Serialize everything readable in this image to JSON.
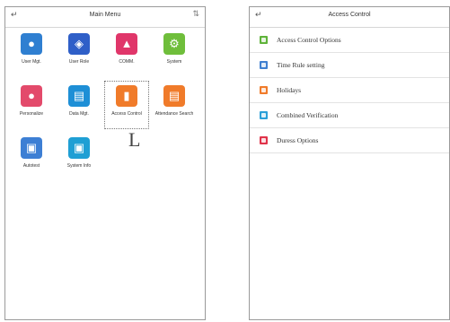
{
  "main_menu": {
    "title": "Main Menu",
    "back_icon": "back-arrow-icon",
    "sort_icon": "sort-arrows-icon",
    "items": [
      {
        "label": "User Mgt.",
        "icon": "user-icon",
        "color": "#2f7fd1"
      },
      {
        "label": "User Role",
        "icon": "shield-icon",
        "color": "#2f5fc8"
      },
      {
        "label": "COMM.",
        "icon": "antenna-icon",
        "color": "#e0366a"
      },
      {
        "label": "System",
        "icon": "gear-icon",
        "color": "#6fbe3b"
      },
      {
        "label": "Personalize",
        "icon": "palette-icon",
        "color": "#e34a6b"
      },
      {
        "label": "Data Mgt.",
        "icon": "database-icon",
        "color": "#1e8fd6"
      },
      {
        "label": "Access Control",
        "icon": "door-icon",
        "color": "#f07b2a"
      },
      {
        "label": "Attendance Search",
        "icon": "document-icon",
        "color": "#f07b2a"
      },
      {
        "label": "Autotest",
        "icon": "test-screen-icon",
        "color": "#3d7fd4"
      },
      {
        "label": "System Info",
        "icon": "monitor-icon",
        "color": "#1f9fd4"
      }
    ],
    "selected": "Access Control"
  },
  "access_control": {
    "title": "Access Control",
    "back_icon": "back-arrow-icon",
    "items": [
      {
        "label": "Access Control Options",
        "color": "#5fb33a"
      },
      {
        "label": "Time Rule setting",
        "color": "#3f7fd0"
      },
      {
        "label": "Holidays",
        "color": "#f07b2a"
      },
      {
        "label": "Combined Verification",
        "color": "#2a9fd8"
      },
      {
        "label": "Duress Options",
        "color": "#e0334a"
      }
    ]
  }
}
